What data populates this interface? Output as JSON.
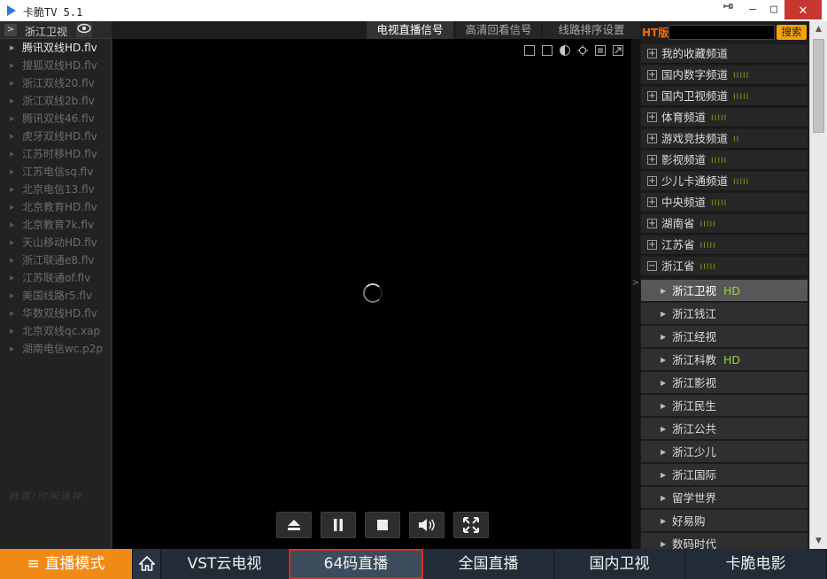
{
  "window": {
    "title": "卡脆TV 5.1",
    "pin_icon": "pin-icon",
    "minimize": "—",
    "maximize": "□",
    "close": "✕"
  },
  "left_header": {
    "channel": "浙江卫视"
  },
  "sources": [
    "腾讯双线HD.flv",
    "搜狐双线HD.flv",
    "浙江双线20.flv",
    "浙江双线2b.flv",
    "腾讯双线46.flv",
    "虎牙双线HD.flv",
    "江苏时移HD.flv",
    "江苏电信sq.flv",
    "北京电信13.flv",
    "北京教育HD.flv",
    "北京教育7k.flv",
    "天山移动HD.flv",
    "浙江联通e8.flv",
    "江苏联通of.flv",
    "美国线路r5.flv",
    "华数双线HD.flv",
    "北京双线qc.xap",
    "湖南电信wc.p2p"
  ],
  "active_source_index": 0,
  "left_footer": "线路/时间选择",
  "tabs": {
    "live": "电视直播信号",
    "hd_replay": "高清回看信号",
    "sort": "线路排序设置"
  },
  "search": {
    "label": "HT版",
    "placeholder": "",
    "button": "搜索"
  },
  "categories": [
    {
      "label": "我的收藏频道",
      "bars": ""
    },
    {
      "label": "国内数字频道",
      "bars": "IIIII"
    },
    {
      "label": "国内卫视频道",
      "bars": "IIIII"
    },
    {
      "label": "体育频道",
      "bars": "IIIII"
    },
    {
      "label": "游戏竞技频道",
      "bars": "II"
    },
    {
      "label": "影视频道",
      "bars": "IIIII"
    },
    {
      "label": "少儿卡通频道",
      "bars": "IIIII"
    },
    {
      "label": "中央频道",
      "bars": "IIIII"
    },
    {
      "label": "湖南省",
      "bars": "IIIII"
    },
    {
      "label": "江苏省",
      "bars": "IIIII"
    },
    {
      "label": "浙江省",
      "bars": "IIIII"
    }
  ],
  "expanded_sign": "−",
  "collapsed_sign": "+",
  "subchannels": [
    {
      "label": "浙江卫视",
      "hd": "HD"
    },
    {
      "label": "浙江钱江",
      "hd": ""
    },
    {
      "label": "浙江经视",
      "hd": ""
    },
    {
      "label": "浙江科教",
      "hd": "HD"
    },
    {
      "label": "浙江影视",
      "hd": ""
    },
    {
      "label": "浙江民生",
      "hd": ""
    },
    {
      "label": "浙江公共",
      "hd": ""
    },
    {
      "label": "浙江少儿",
      "hd": ""
    },
    {
      "label": "浙江国际",
      "hd": ""
    },
    {
      "label": "留学世界",
      "hd": ""
    },
    {
      "label": "好易购",
      "hd": ""
    },
    {
      "label": "数码时代",
      "hd": ""
    }
  ],
  "active_subchannel_index": 0,
  "bottom_nav": {
    "mode": "≡ 直播模式",
    "vst": "VST云电视",
    "code64": "64码直播",
    "national": "全国直播",
    "satellite": "国内卫视",
    "movie": "卡脆电影"
  },
  "colors": {
    "accent": "#f18a14",
    "hd": "#9ad23e",
    "highlight_border": "#d6302a",
    "close": "#c7372f"
  }
}
